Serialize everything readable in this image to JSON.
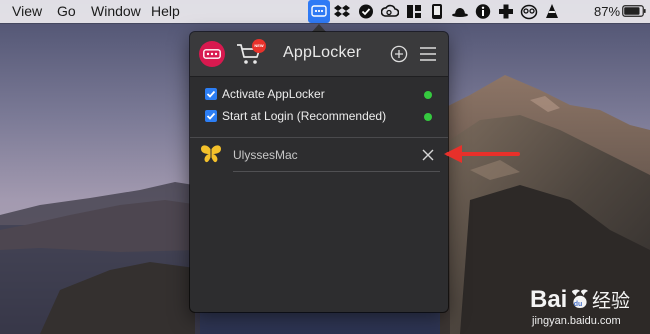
{
  "menubar": {
    "items": [
      "View",
      "Go",
      "Window",
      "Help"
    ],
    "status_icons": [
      "applocker-icon",
      "dropbox-icon",
      "check-circle-icon",
      "creative-cloud-icon",
      "grid-icon",
      "phone-icon",
      "bowler-hat-icon",
      "info-icon",
      "plus-icon",
      "owl-icon",
      "cone-icon"
    ],
    "battery_text": "87%",
    "battery_level": 0.87
  },
  "panel": {
    "title": "AppLocker",
    "cart_badge": "NEW",
    "options": [
      {
        "label": "Activate AppLocker",
        "checked": true,
        "status": "active"
      },
      {
        "label": "Start at Login (Recommended)",
        "checked": true,
        "status": "active"
      }
    ],
    "locked_apps": [
      {
        "name": "UlyssesMac",
        "icon": "butterfly-icon"
      }
    ]
  },
  "watermark": {
    "brand": "Bai",
    "brand_suffix": "经验",
    "url": "jingyan.baidu.com"
  },
  "colors": {
    "accent": "#2c7ef5",
    "status_green": "#35c93f",
    "logo": "#d8194f",
    "annotation_arrow": "#e8302a"
  }
}
